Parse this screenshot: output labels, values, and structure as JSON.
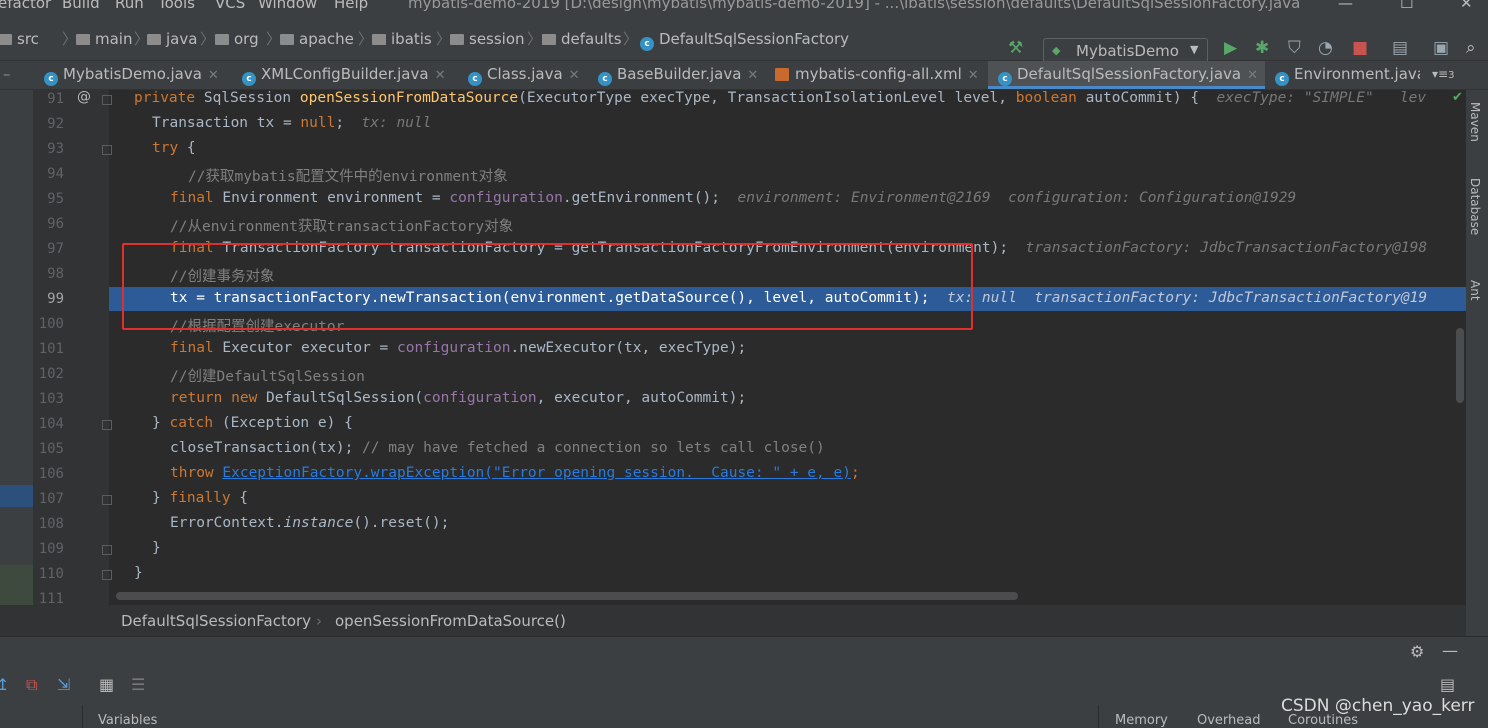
{
  "menu": {
    "items": [
      "efactor",
      "Build",
      "Run",
      "Tools",
      "VCS",
      "Window",
      "Help"
    ],
    "title": "mybatis-demo-2019 [D:\\design\\mybatis\\mybatis-demo-2019] - ...\\ibatis\\session\\defaults\\DefaultSqlSessionFactory.java"
  },
  "breadcrumb": {
    "items": [
      "src",
      "main",
      "java",
      "org",
      "apache",
      "ibatis",
      "session",
      "defaults",
      "DefaultSqlSessionFactory"
    ]
  },
  "toolbar": {
    "run_config": "MybatisDemo"
  },
  "tabs": [
    {
      "label": "MybatisDemo.java",
      "icon": "class-icon"
    },
    {
      "label": "XMLConfigBuilder.java",
      "icon": "class-icon"
    },
    {
      "label": "Class.java",
      "icon": "class-icon"
    },
    {
      "label": "BaseBuilder.java",
      "icon": "class-icon"
    },
    {
      "label": "mybatis-config-all.xml",
      "icon": "xml-icon"
    },
    {
      "label": "DefaultSqlSessionFactory.java",
      "icon": "class-icon",
      "active": true
    },
    {
      "label": "Environment.java",
      "icon": "class-icon"
    }
  ],
  "tabs_overflow": "3",
  "editor": {
    "line_numbers": [
      "91",
      "92",
      "93",
      "94",
      "95",
      "96",
      "97",
      "98",
      "99",
      "100",
      "101",
      "102",
      "103",
      "104",
      "105",
      "106",
      "107",
      "108",
      "109",
      "110",
      "111"
    ],
    "current_line": "99",
    "line_91": {
      "kw1": "private ",
      "t1": "SqlSession ",
      "m": "openSessionFromDataSource",
      "t2": "(ExecutorType execType, TransactionIsolationLevel level, ",
      "kw2": "boolean ",
      "t3": "autoCommit) {",
      "hint": "execType: \"SIMPLE\"   lev"
    },
    "line_92": {
      "t1": "Transaction tx = ",
      "kw": "null",
      "t2": ";",
      "hint": "tx: null"
    },
    "line_93": {
      "kw": "try",
      "t": " {"
    },
    "line_94": {
      "com": "//获取mybatis配置文件中的environment对象"
    },
    "line_95": {
      "kw": "final ",
      "t1": "Environment environment = ",
      "f": "configuration",
      "t2": ".getEnvironment();",
      "hint": "environment: Environment@2169  configuration: Configuration@1929"
    },
    "line_96": {
      "com": "//从environment获取transactionFactory对象"
    },
    "line_97": {
      "kw": "final ",
      "t": "TransactionFactory transactionFactory = getTransactionFactoryFromEnvironment(environment);",
      "hint": "transactionFactory: JdbcTransactionFactory@198"
    },
    "line_98": {
      "com": "//创建事务对象"
    },
    "line_99": {
      "t": "tx = transactionFactory.newTransaction(environment.getDataSource(), level, autoCommit);",
      "hint": "tx: null  transactionFactory: JdbcTransactionFactory@19"
    },
    "line_100": {
      "com": "//根据配置创建executor"
    },
    "line_101": {
      "kw": "final ",
      "t1": "Executor executor = ",
      "f": "configuration",
      "t2": ".newExecutor(tx, execType);"
    },
    "line_102": {
      "com": "//创建DefaultSqlSession"
    },
    "line_103": {
      "kw1": "return ",
      "kw2": "new ",
      "t1": "DefaultSqlSession(",
      "f": "configuration",
      "t2": ", executor, autoCommit);"
    },
    "line_104": {
      "t1": "} ",
      "kw": "catch",
      "t2": " (Exception e) {"
    },
    "line_105": {
      "t": "closeTransaction(tx);",
      "com": " // may have fetched a connection so lets call close()"
    },
    "line_106": {
      "kw": "throw ",
      "link": "ExceptionFactory.wrapException(\"Error opening session.  Cause: \" + e, e)",
      "t": ";"
    },
    "line_107": {
      "t1": "} ",
      "kw": "finally",
      "t2": " {"
    },
    "line_108": {
      "t1": "ErrorContext.",
      "i": "instance",
      "t2": "().reset();"
    },
    "line_109": {
      "t": "}"
    },
    "line_110": {
      "t": "}"
    }
  },
  "code_breadcrumb": {
    "class": "DefaultSqlSessionFactory",
    "method": "openSessionFromDataSource()"
  },
  "right_tools": [
    "Maven",
    "Database",
    "Ant"
  ],
  "debug": {
    "variables_label": "Variables",
    "memory_label": "Memory",
    "overhead_label": "Overhead",
    "coroutines_label": "Coroutines"
  },
  "watermark": "CSDN @chen_yao_kerr"
}
